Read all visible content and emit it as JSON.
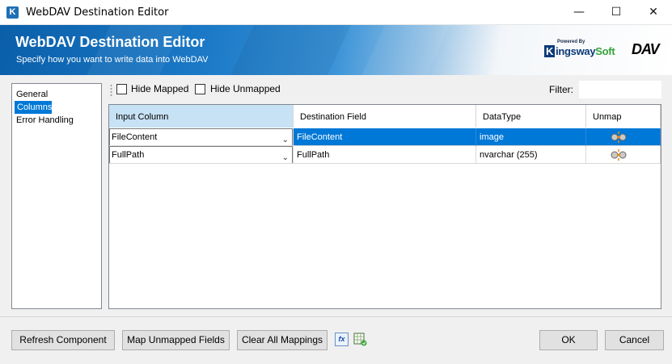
{
  "window": {
    "title": "WebDAV Destination Editor",
    "app_icon_letter": "K",
    "minimize_glyph": "—",
    "maximize_glyph": "☐",
    "close_glyph": "✕"
  },
  "banner": {
    "title": "WebDAV Destination Editor",
    "subtitle": "Specify how you want to write data into WebDAV",
    "powered_by": "Powered By",
    "brand_k": "K",
    "brand_ingsway": "ingsway",
    "brand_soft": "Soft",
    "product_logo": "DAV"
  },
  "nav": {
    "items": [
      {
        "label": "General",
        "active": false
      },
      {
        "label": "Columns",
        "active": true
      },
      {
        "label": "Error Handling",
        "active": false
      }
    ]
  },
  "toolbar": {
    "hide_mapped": {
      "label": "Hide Mapped",
      "checked": false
    },
    "hide_unmapped": {
      "label": "Hide Unmapped",
      "checked": false
    },
    "filter_label": "Filter:",
    "filter_value": ""
  },
  "grid": {
    "columns": [
      "Input Column",
      "Destination Field",
      "DataType",
      "Unmap"
    ],
    "rows": [
      {
        "input": "FileContent",
        "destination": "FileContent",
        "datatype": "image",
        "selected": true
      },
      {
        "input": "FullPath",
        "destination": "FullPath",
        "datatype": "nvarchar (255)",
        "selected": false
      }
    ]
  },
  "buttons": {
    "refresh": "Refresh Component",
    "map_unmapped": "Map Unmapped Fields",
    "clear_mappings": "Clear All Mappings",
    "fx_icon": "fx",
    "ok": "OK",
    "cancel": "Cancel"
  },
  "colors": {
    "selection": "#0078d7",
    "header_selected": "#c7e1f5",
    "banner_blue": "#1a78c6"
  }
}
